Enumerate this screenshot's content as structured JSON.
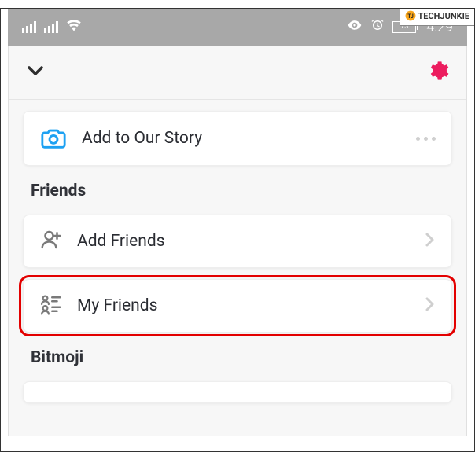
{
  "watermark": {
    "text": "TECHJUNKIE"
  },
  "status_bar": {
    "battery_percent": "73",
    "time": "4:29"
  },
  "story_card": {
    "label": "Add to Our Story"
  },
  "sections": {
    "friends": {
      "title": "Friends",
      "add_friends": "Add Friends",
      "my_friends": "My Friends"
    },
    "bitmoji": {
      "title": "Bitmoji"
    }
  }
}
